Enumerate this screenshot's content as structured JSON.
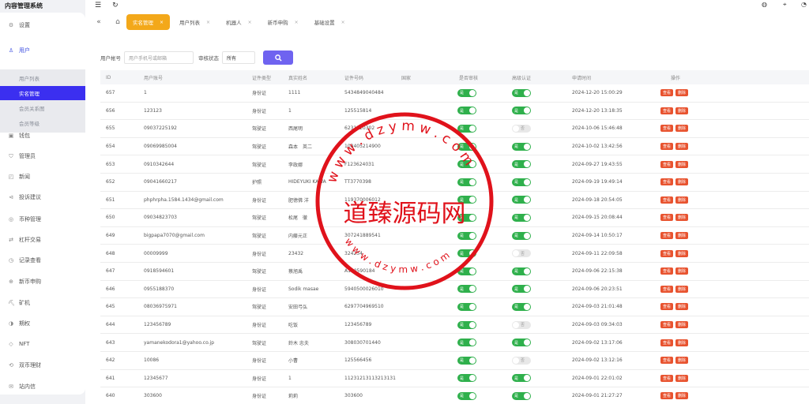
{
  "app": {
    "title": "内容管理系统"
  },
  "topbar": {
    "icons": [
      "menu-toggle-icon",
      "refresh-icon",
      "palette-icon",
      "tag-icon",
      "user-icon"
    ]
  },
  "sidebar": {
    "items": [
      {
        "label": "设置",
        "icon": "gear-icon"
      },
      {
        "label": "用户",
        "icon": "user-icon"
      },
      {
        "label": "钱包",
        "icon": "wallet-icon"
      },
      {
        "label": "管理员",
        "icon": "shield-icon"
      },
      {
        "label": "新闻",
        "icon": "news-icon"
      },
      {
        "label": "投诉建议",
        "icon": "megaphone-icon"
      },
      {
        "label": "币种管理",
        "icon": "coin-icon"
      },
      {
        "label": "杠杆交易",
        "icon": "exchange-icon"
      },
      {
        "label": "记录查看",
        "icon": "record-icon"
      },
      {
        "label": "新币申购",
        "icon": "newcoin-icon"
      },
      {
        "label": "矿机",
        "icon": "miner-icon"
      },
      {
        "label": "期权",
        "icon": "option-icon"
      },
      {
        "label": "NFT",
        "icon": "nft-icon"
      },
      {
        "label": "双币理财",
        "icon": "finance-icon"
      },
      {
        "label": "站内信",
        "icon": "message-icon"
      }
    ],
    "submenu": [
      "用户列表",
      "实名管理",
      "会员关系图",
      "会员等级"
    ]
  },
  "tabs": [
    {
      "label": "实名管理",
      "active": true
    },
    {
      "label": "用户列表"
    },
    {
      "label": "机器人"
    },
    {
      "label": "新币申购"
    },
    {
      "label": "基础设置"
    }
  ],
  "search": {
    "account_label": "用户帐号",
    "account_placeholder": "用户手机号或邮箱",
    "status_label": "审核状态",
    "status_value": "所有"
  },
  "table": {
    "headers": [
      "ID",
      "用户账号",
      "证件类型",
      "真实姓名",
      "证件号码",
      "国家",
      "是否审核",
      "高级认证",
      "申请时间",
      "操作"
    ],
    "rows": [
      {
        "id": "657",
        "account": "1",
        "type": "身份证",
        "name": "1111",
        "code": "5434849040484",
        "audit": true,
        "adv": true,
        "time": "2024-12-20 15:00:29"
      },
      {
        "id": "656",
        "account": "123123",
        "type": "身份证",
        "name": "1",
        "code": "125515814",
        "audit": true,
        "adv": true,
        "time": "2024-12-20 13:18:35"
      },
      {
        "id": "655",
        "account": "09037225192",
        "type": "驾驶证",
        "name": "西尾明",
        "code": "6231120302",
        "audit": true,
        "adv": false,
        "time": "2024-10-06 15:46:48"
      },
      {
        "id": "654",
        "account": "09069985004",
        "type": "驾驶证",
        "name": "森本　英二",
        "code": "108405214900",
        "audit": true,
        "adv": true,
        "time": "2024-10-02 13:42:56"
      },
      {
        "id": "653",
        "account": "0910342644",
        "type": "驾驶证",
        "name": "李政娜",
        "code": "F123624031",
        "audit": true,
        "adv": true,
        "time": "2024-09-27 19:43:55"
      },
      {
        "id": "652",
        "account": "09041660217",
        "type": "护照",
        "name": "HIDEYUKI KAWA",
        "code": "TT3770398",
        "audit": true,
        "adv": true,
        "time": "2024-09-19 19:49:14"
      },
      {
        "id": "651",
        "account": "phphrpha.1584.1434@gmail.com",
        "type": "身份证",
        "name": "肥徳佛 洋",
        "code": "119370006012",
        "audit": true,
        "adv": true,
        "time": "2024-09-18 20:54:05"
      },
      {
        "id": "650",
        "account": "09034823703",
        "type": "驾驶证",
        "name": "松尾　徹",
        "code": "",
        "audit": true,
        "adv": true,
        "time": "2024-09-15 20:08:44"
      },
      {
        "id": "649",
        "account": "bigpapa7070@gmail.com",
        "type": "驾驶证",
        "name": "内藤元正",
        "code": "307241889541",
        "audit": true,
        "adv": true,
        "time": "2024-09-14 10:50:17"
      },
      {
        "id": "648",
        "account": "00009999",
        "type": "身份证",
        "name": "23432",
        "code": "324234",
        "audit": true,
        "adv": false,
        "time": "2024-09-11 22:09:58"
      },
      {
        "id": "647",
        "account": "0918594601",
        "type": "驾驶证",
        "name": "蔡旭禹",
        "code": "A100590184",
        "audit": true,
        "adv": true,
        "time": "2024-09-06 22:15:38"
      },
      {
        "id": "646",
        "account": "0955188370",
        "type": "身份证",
        "name": "Sodik masae",
        "code": "5940500026010",
        "audit": true,
        "adv": true,
        "time": "2024-09-06 20:23:51"
      },
      {
        "id": "645",
        "account": "08036975971",
        "type": "驾驶证",
        "name": "安田弓弘",
        "code": "6297704969510",
        "audit": true,
        "adv": true,
        "time": "2024-09-03 21:01:48"
      },
      {
        "id": "644",
        "account": "123456789",
        "type": "身份证",
        "name": "吃饭",
        "code": "123456789",
        "audit": true,
        "adv": false,
        "time": "2024-09-03 09:34:03"
      },
      {
        "id": "643",
        "account": "yamanekodora1@yahoo.co.jp",
        "type": "驾驶证",
        "name": "鈴木 忠夫",
        "code": "308030701440",
        "audit": true,
        "adv": true,
        "time": "2024-09-02 13:17:06"
      },
      {
        "id": "642",
        "account": "10086",
        "type": "身份证",
        "name": "小曹",
        "code": "125566456",
        "audit": true,
        "adv": false,
        "time": "2024-09-02 13:12:16"
      },
      {
        "id": "641",
        "account": "12345677",
        "type": "身份证",
        "name": "1",
        "code": "11231213113213131",
        "audit": true,
        "adv": true,
        "time": "2024-09-01 22:01:02"
      },
      {
        "id": "640",
        "account": "303600",
        "type": "身份证",
        "name": "莉莉",
        "code": "303600",
        "audit": true,
        "adv": true,
        "time": "2024-09-01 21:27:27"
      }
    ],
    "switch_on": "是",
    "switch_off": "否",
    "op_view": "查看",
    "op_delete": "删除"
  },
  "watermark": {
    "text": "道臻源码网",
    "url_top": "w w w . d z y m w . c o m",
    "url_bottom": "w w w . d z y m w . c o m",
    "color": "#e0121b"
  },
  "colors": {
    "primary": "#3b2ff0",
    "tab_active": "#f3a81a",
    "switch_on": "#2fb04c",
    "danger": "#e8532f"
  }
}
